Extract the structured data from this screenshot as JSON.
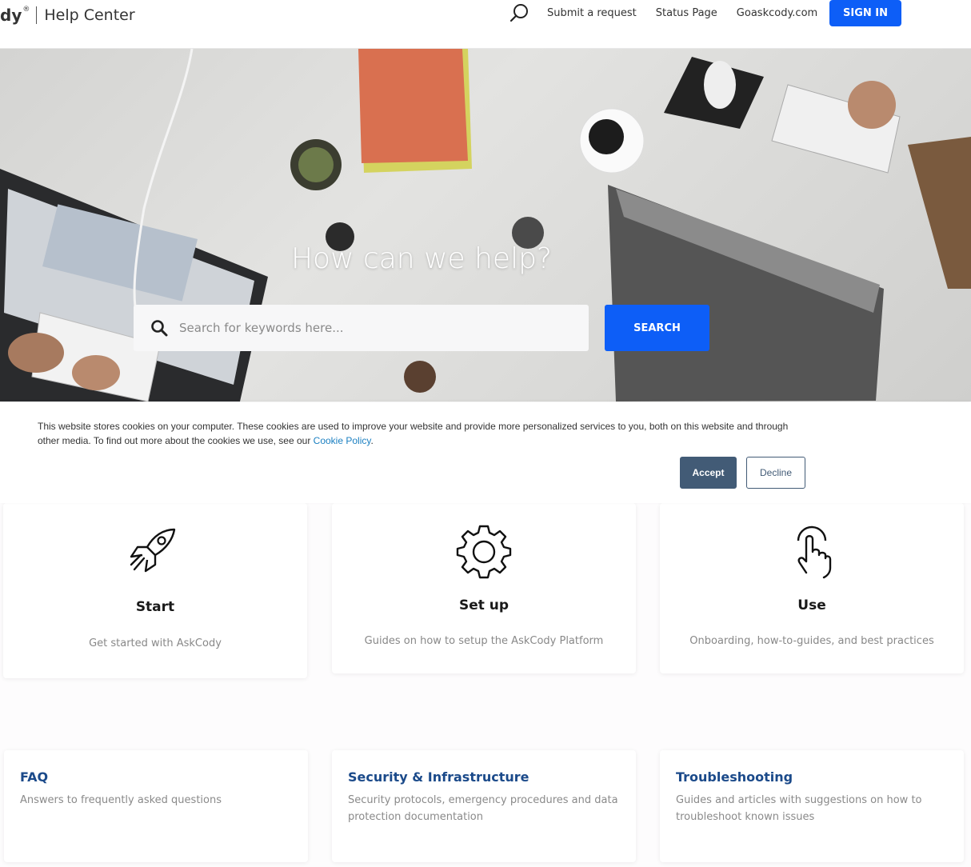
{
  "header": {
    "brand": "dy",
    "brand_reg": "®",
    "product": "Help Center",
    "nav": {
      "submit_request": "Submit a request",
      "status_page": "Status Page",
      "site_link": "Goaskcody.com"
    },
    "sign_in": "SIGN IN"
  },
  "hero": {
    "title": "How can we help?",
    "search_placeholder": "Search for keywords here...",
    "search_button": "SEARCH"
  },
  "cookie_banner": {
    "text": "This website stores cookies on your computer. These cookies are used to improve your website and provide more personalized services to you, both on this website and through other media. To find out more about the cookies we use, see our ",
    "link": "Cookie Policy",
    "text_end": ".",
    "accept": "Accept",
    "decline": "Decline"
  },
  "categories": [
    {
      "title": "Start",
      "description": "Get started with AskCody",
      "icon": "rocket-icon"
    },
    {
      "title": "Set up",
      "description": "Guides on how to setup the AskCody Platform",
      "icon": "gear-icon"
    },
    {
      "title": "Use",
      "description": "Onboarding, how-to-guides, and best practices",
      "icon": "hand-pointer-icon"
    }
  ],
  "sections": [
    {
      "title": "FAQ",
      "description": "Answers to frequently asked questions"
    },
    {
      "title": "Security & Infrastructure",
      "description": "Security protocols, emergency procedures and data protection documentation"
    },
    {
      "title": "Troubleshooting",
      "description": "Guides and articles with suggestions on how to troubleshoot known issues"
    }
  ],
  "colors": {
    "primary": "#0d5ef7",
    "cookie_accept": "#425b76",
    "section_title": "#1b4a8a"
  }
}
